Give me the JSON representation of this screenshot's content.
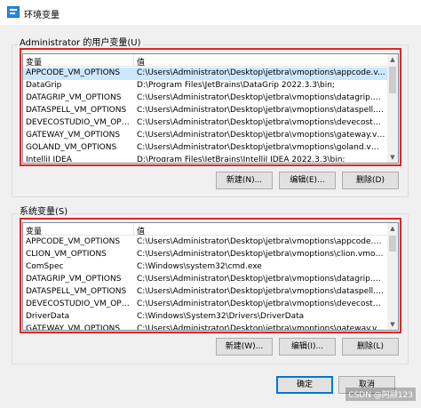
{
  "window": {
    "title": "环境变量"
  },
  "user_vars": {
    "label": "Administrator 的用户变量(U)",
    "columns": [
      "变量",
      "值"
    ],
    "rows": [
      {
        "name": "APPCODE_VM_OPTIONS",
        "value": "C:\\Users\\Administrator\\Desktop\\jetbra\\vmoptions\\appcode.v...",
        "selected": true
      },
      {
        "name": "DataGrip",
        "value": "D:\\Program Files\\JetBrains\\DataGrip 2022.3.3\\bin;"
      },
      {
        "name": "DATAGRIP_VM_OPTIONS",
        "value": "C:\\Users\\Administrator\\Desktop\\jetbra\\vmoptions\\datagrip.vm..."
      },
      {
        "name": "DATASPELL_VM_OPTIONS",
        "value": "C:\\Users\\Administrator\\Desktop\\jetbra\\vmoptions\\dataspell.vm..."
      },
      {
        "name": "DEVECOSTUDIO_VM_OPTI...",
        "value": "C:\\Users\\Administrator\\Desktop\\jetbra\\vmoptions\\devecostudi..."
      },
      {
        "name": "GATEWAY_VM_OPTIONS",
        "value": "C:\\Users\\Administrator\\Desktop\\jetbra\\vmoptions\\gateway.vmo..."
      },
      {
        "name": "GOLAND_VM_OPTIONS",
        "value": "C:\\Users\\Administrator\\Desktop\\jetbra\\vmoptions\\goland.vmo..."
      },
      {
        "name": "IntelliJ IDEA",
        "value": "D:\\Program Files\\JetBrains\\IntelliJ IDEA 2022.3.3\\bin;"
      }
    ],
    "buttons": {
      "new": "新建(N)...",
      "edit": "编辑(E)...",
      "delete": "删除(D)"
    }
  },
  "system_vars": {
    "label": "系统变量(S)",
    "columns": [
      "变量",
      "值"
    ],
    "rows": [
      {
        "name": "APPCODE_VM_OPTIONS",
        "value": "C:\\Users\\Administrator\\Desktop\\jetbra\\vmoptions\\appcode.vm..."
      },
      {
        "name": "CLION_VM_OPTIONS",
        "value": "C:\\Users\\Administrator\\Desktop\\jetbra\\vmoptions\\clion.vmopt..."
      },
      {
        "name": "ComSpec",
        "value": "C:\\Windows\\system32\\cmd.exe"
      },
      {
        "name": "DATAGRIP_VM_OPTIONS",
        "value": "C:\\Users\\Administrator\\Desktop\\jetbra\\vmoptions\\datagrip.vm..."
      },
      {
        "name": "DATASPELL_VM_OPTIONS",
        "value": "C:\\Users\\Administrator\\Desktop\\jetbra\\vmoptions\\dataspell.vm..."
      },
      {
        "name": "DEVECOSTUDIO_VM_OPTI...",
        "value": "C:\\Users\\Administrator\\Desktop\\jetbra\\vmoptions\\devecostudi..."
      },
      {
        "name": "DriverData",
        "value": "C:\\Windows\\System32\\Drivers\\DriverData"
      },
      {
        "name": "GATEWAY_VM_OPTIONS",
        "value": "C:\\Users\\Administrator\\Desktop\\jetbra\\vmoptions\\gateway.vmo..."
      }
    ],
    "buttons": {
      "new": "新建(W)...",
      "edit": "编辑(I)...",
      "delete": "删除(L)"
    }
  },
  "footer": {
    "ok": "确定",
    "cancel": "取消",
    "watermark": "CSDN @阿顾123"
  },
  "colors": {
    "highlight_frame": "#e0262a",
    "selection": "#cce8ff",
    "primary_border": "#0078d7"
  }
}
